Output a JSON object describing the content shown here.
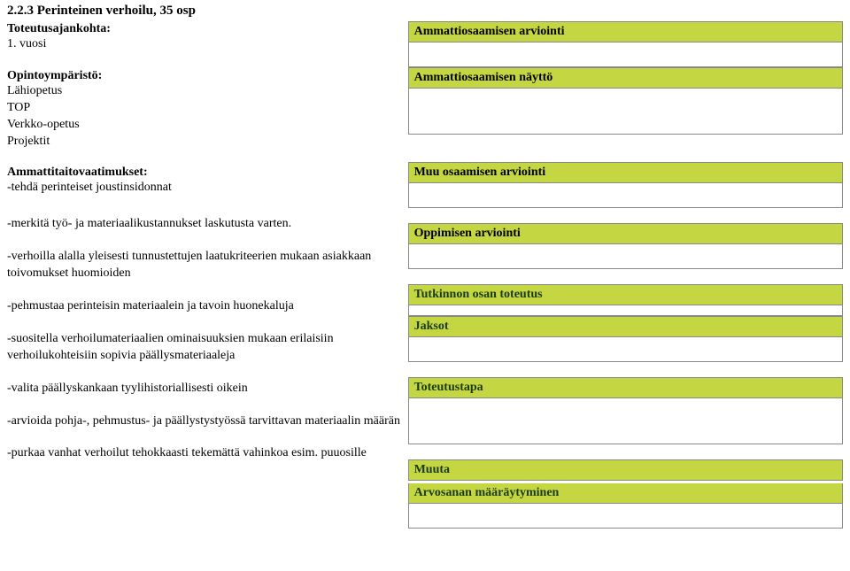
{
  "left": {
    "heading": "2.2.3 Perinteinen verhoilu, 35 osp",
    "timingLabel": "Toteutusajankohta:",
    "timingValue": "1. vuosi",
    "envLabel": "Opintoympäristö:",
    "envItems": [
      "Lähiopetus",
      "TOP",
      "Verkko-opetus",
      "Projektit"
    ],
    "reqLabel": "Ammattitaitovaatimukset:",
    "reqItems": [
      "-tehdä perinteiset joustinsidonnat",
      "-merkitä työ- ja materiaalikustannukset laskutusta varten.",
      "-verhoilla alalla yleisesti tunnustettujen laatukriteerien mukaan asiakkaan toivomukset huomioiden",
      "-pehmustaa perinteisin materiaalein ja tavoin huonekaluja",
      "-suositella verhoilumateriaalien ominaisuuksien mukaan erilaisiin verhoilukohteisiin sopivia päällysmateriaaleja",
      "-valita päällyskankaan tyylihistoriallisesti oikein",
      "-arvioida pohja-, pehmustus- ja päällystystyössä tarvittavan materiaalin määrän",
      "-purkaa vanhat verhoilut tehokkaasti tekemättä vahinkoa esim. puuosille"
    ]
  },
  "right": {
    "bars": {
      "ammattiosaamisenArviointi": "Ammattiosaamisen arviointi",
      "ammattiosaamisenNaytto": "Ammattiosaamisen näyttö",
      "muuOsaamisenArviointi": "Muu osaamisen arviointi",
      "oppimisenArviointi": "Oppimisen arviointi",
      "tutkinnonOsanToteutus": "Tutkinnon osan toteutus",
      "jaksot": "Jaksot",
      "toteutustapa": "Toteutustapa",
      "muuta": "Muuta",
      "arvosananMaaraytyminen": "Arvosanan määräytyminen"
    }
  }
}
